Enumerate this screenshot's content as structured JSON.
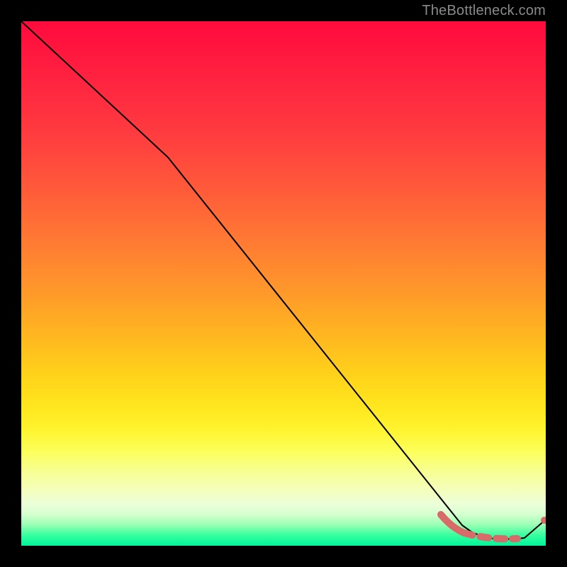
{
  "watermark": "TheBottleneck.com",
  "chart_data": {
    "type": "line",
    "title": "",
    "xlabel": "",
    "ylabel": "",
    "xlim": [
      0,
      100
    ],
    "ylim": [
      0,
      100
    ],
    "series": [
      {
        "name": "bottleneck-curve",
        "style": "solid-thin-black",
        "x": [
          0,
          28,
          84,
          86,
          88,
          90,
          92,
          94,
          96,
          100
        ],
        "y": [
          100,
          74,
          4,
          2.5,
          1.8,
          1.4,
          1.3,
          1.3,
          1.5,
          5
        ]
      },
      {
        "name": "optimal-segment",
        "style": "thick-salmon-dashed",
        "x": [
          80,
          83,
          85,
          88,
          91,
          94,
          97,
          100
        ],
        "y": [
          6,
          3,
          2.2,
          1.5,
          1.3,
          1.3,
          1.6,
          5
        ]
      }
    ],
    "colors": {
      "curve": "#000000",
      "segment": "#d86a6a",
      "gradient_top": "#ff0b3d",
      "gradient_mid": "#ffd41a",
      "gradient_bottom": "#00f49a"
    }
  }
}
